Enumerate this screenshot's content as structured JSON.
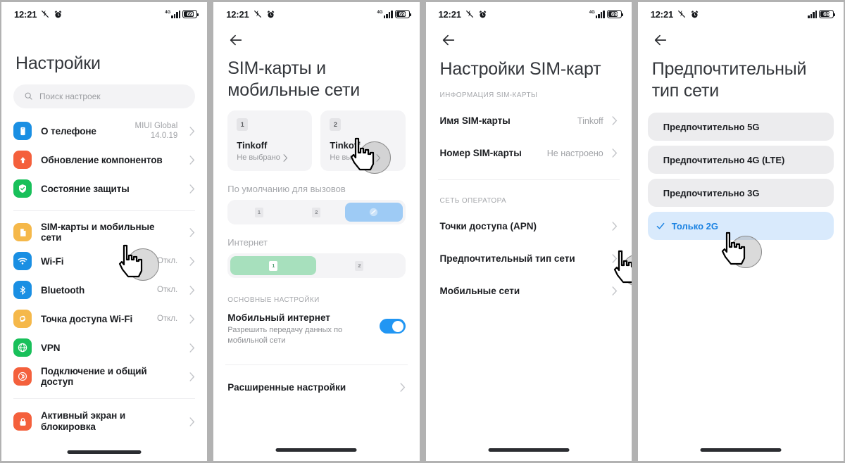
{
  "status_bar": {
    "time": "12:21",
    "icons": [
      "mute-icon",
      "alarm-icon"
    ],
    "network_label": "4G",
    "battery_percent": "69"
  },
  "panels": [
    {
      "name": "settings-home",
      "title": "Настройки",
      "search": {
        "placeholder": "Поиск настроек",
        "value": ""
      },
      "group_1": [
        {
          "label": "О телефоне",
          "value": "MIUI Global\n14.0.19",
          "icon": "phone-icon",
          "color": "#1a8fe3"
        },
        {
          "label": "Обновление компонентов",
          "value": "",
          "icon": "up-arrow-icon",
          "color": "#f4603c"
        },
        {
          "label": "Состояние защиты",
          "value": "",
          "icon": "shield-check-icon",
          "color": "#18c05a"
        }
      ],
      "group_2": [
        {
          "label": "SIM-карты и мобильные сети",
          "value": "",
          "icon": "sim-card-icon",
          "color": "#f5b84a"
        },
        {
          "label": "Wi-Fi",
          "value": "Откл.",
          "icon": "wifi-icon",
          "color": "#1a8fe3"
        },
        {
          "label": "Bluetooth",
          "value": "Откл.",
          "icon": "bluetooth-icon",
          "color": "#1a8fe3"
        },
        {
          "label": "Точка доступа Wi-Fi",
          "value": "Откл.",
          "icon": "hotspot-icon",
          "color": "#f5b84a"
        },
        {
          "label": "VPN",
          "value": "",
          "icon": "globe-icon",
          "color": "#18c05a"
        },
        {
          "label": "Подключение и общий доступ",
          "value": "",
          "icon": "share-icon",
          "color": "#f4603c"
        }
      ],
      "group_3": [
        {
          "label": "Активный экран и\nблокировка",
          "value": "",
          "icon": "lock-icon",
          "color": "#f4603c"
        }
      ]
    },
    {
      "name": "sim-and-mobile-networks",
      "title": "SIM-карты и мобильные сети",
      "sim_cards": [
        {
          "slot": "1",
          "operator": "Tinkoff",
          "status": "Не выбрано"
        },
        {
          "slot": "2",
          "operator": "Tinkoff",
          "status": "Не выбрано"
        }
      ],
      "calls_label": "По умолчанию для вызовов",
      "calls_segments": [
        {
          "slot": "1",
          "selected": false
        },
        {
          "slot": "2",
          "selected": false
        },
        {
          "slot": "ask",
          "selected": true
        }
      ],
      "internet_label": "Интернет",
      "internet_segments": [
        {
          "slot": "1",
          "selected": true
        },
        {
          "slot": "2",
          "selected": false
        }
      ],
      "section_main": "ОСНОВНЫЕ НАСТРОЙКИ",
      "mobile_data": {
        "title": "Мобильный интернет",
        "subtitle": "Разрешить передачу данных по мобильной сети",
        "enabled": true
      },
      "advanced_label": "Расширенные настройки"
    },
    {
      "name": "sim-settings",
      "title": "Настройки SIM-карт",
      "section_info": "ИНФОРМАЦИЯ SIM-КАРТЫ",
      "info_rows": [
        {
          "key": "Имя SIM-карты",
          "value": "Tinkoff"
        },
        {
          "key": "Номер SIM-карты",
          "value": "Не настроено"
        }
      ],
      "section_operator": "СЕТЬ ОПЕРАТОРА",
      "operator_rows": [
        {
          "key": "Точки доступа (APN)",
          "value": ""
        },
        {
          "key": "Предпочтительный тип сети",
          "value": ""
        },
        {
          "key": "Мобильные сети",
          "value": ""
        }
      ]
    },
    {
      "name": "preferred-network-type",
      "title": "Предпочтительный тип сети",
      "options": [
        {
          "label": "Предпочтительно 5G",
          "selected": false
        },
        {
          "label": "Предпочтительно 4G (LTE)",
          "selected": false
        },
        {
          "label": "Предпочтительно 3G",
          "selected": false
        },
        {
          "label": "Только 2G",
          "selected": true
        }
      ]
    }
  ],
  "colors": {
    "accent_blue": "#1a82e2",
    "toggle_on": "#2196f3",
    "selected_row_bg": "#d9eafc",
    "segment_green": "#a7e0bd",
    "segment_blue": "#9ecbf5",
    "page_bg": "#b2b2b2"
  }
}
